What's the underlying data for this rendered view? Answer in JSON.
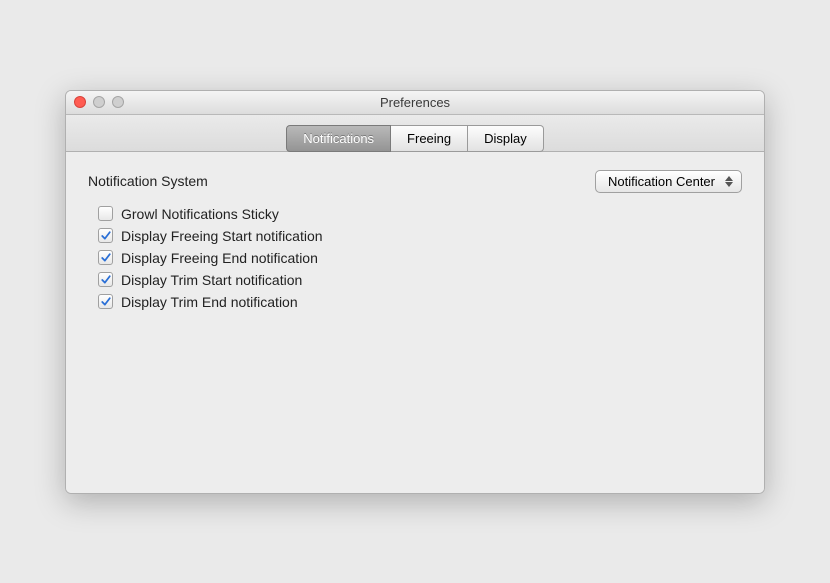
{
  "window": {
    "title": "Preferences"
  },
  "tabs": {
    "notifications": "Notifications",
    "freeing": "Freeing",
    "display": "Display"
  },
  "section": {
    "heading": "Notification System",
    "popup_value": "Notification Center"
  },
  "options": {
    "growl_sticky": "Growl Notifications Sticky",
    "freeing_start": "Display Freeing Start notification",
    "freeing_end": "Display Freeing End notification",
    "trim_start": "Display Trim Start notification",
    "trim_end": "Display Trim End notification"
  },
  "checked": {
    "growl_sticky": false,
    "freeing_start": true,
    "freeing_end": true,
    "trim_start": true,
    "trim_end": true
  }
}
